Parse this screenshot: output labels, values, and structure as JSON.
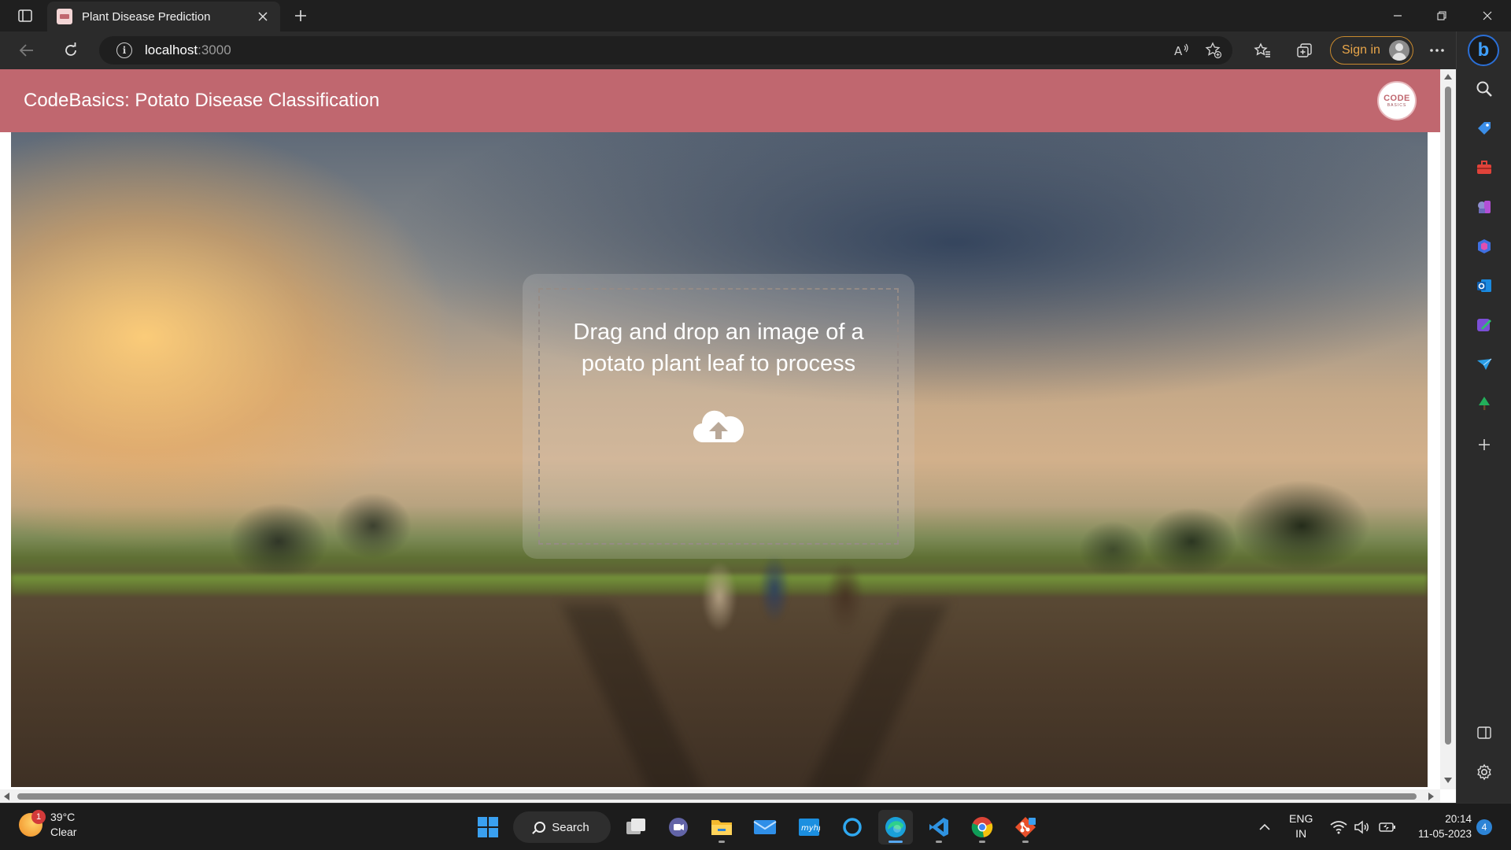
{
  "browser": {
    "tab": {
      "title": "Plant Disease Prediction"
    },
    "address": {
      "host": "localhost",
      "port": ":3000"
    },
    "signin_label": "Sign in"
  },
  "page": {
    "header_title": "CodeBasics: Potato Disease Classification",
    "logo": {
      "top": "CODE",
      "bottom": "BASICS"
    },
    "dropzone_text": "Drag and drop an image of a potato plant leaf to process"
  },
  "taskbar": {
    "weather": {
      "temp": "39°C",
      "condition": "Clear",
      "badge": "1"
    },
    "search_label": "Search",
    "language": {
      "line1": "ENG",
      "line2": "IN"
    },
    "time": "20:14",
    "date": "11-05-2023",
    "notification_count": "4"
  },
  "colors": {
    "header": "#c0676f",
    "signin_border": "#c98a2e",
    "accent_blue": "#2d84d6"
  },
  "icons": [
    "tab-actions-icon",
    "close-icon",
    "plus-icon",
    "minimize-icon",
    "restore-icon",
    "back-icon",
    "refresh-icon",
    "info-icon",
    "read-aloud-icon",
    "add-favorite-icon",
    "favorites-icon",
    "collections-icon",
    "more-icon",
    "bing-icon",
    "search-icon",
    "shopping-icon",
    "tools-icon",
    "games-icon",
    "office-icon",
    "outlook-icon",
    "designer-icon",
    "drop-icon",
    "tree-icon",
    "add-icon",
    "sidebar-toggle-icon",
    "settings-icon",
    "cloud-upload-icon",
    "windows-start-icon",
    "task-view-icon",
    "teams-icon",
    "file-explorer-icon",
    "mail-icon",
    "myhp-icon",
    "cortana-icon",
    "edge-icon",
    "vscode-icon",
    "chrome-icon",
    "git-icon",
    "wifi-icon",
    "volume-icon",
    "battery-icon"
  ]
}
